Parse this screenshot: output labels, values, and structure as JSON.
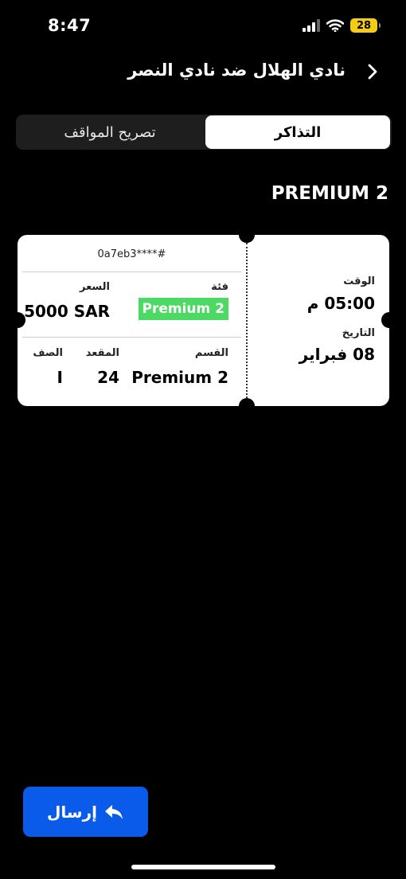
{
  "status": {
    "time": "8:47",
    "battery": "28"
  },
  "header": {
    "title": "نادي الهلال ضد نادي النصر"
  },
  "tabs": {
    "active": "التذاكر",
    "inactive": "تصريح المواقف"
  },
  "ticket": {
    "category_heading": "PREMIUM 2",
    "id": "0a7eb3****#",
    "category_label": "فئة",
    "category_value": "Premium 2",
    "price_label": "السعر",
    "price_value": "5000 SAR",
    "section_label": "القسم",
    "section_value": "Premium 2",
    "seat_label": "المقعد",
    "seat_value": "24",
    "row_label": "الصف",
    "row_value": "I",
    "time_label": "الوقت",
    "time_value": "05:00 م",
    "date_label": "التاريخ",
    "date_value": "08 فبراير"
  },
  "actions": {
    "send_label": "إرسال"
  },
  "colors": {
    "accent": "#0a5bea",
    "badge": "#4cd964",
    "battery": "#f5cc14"
  }
}
